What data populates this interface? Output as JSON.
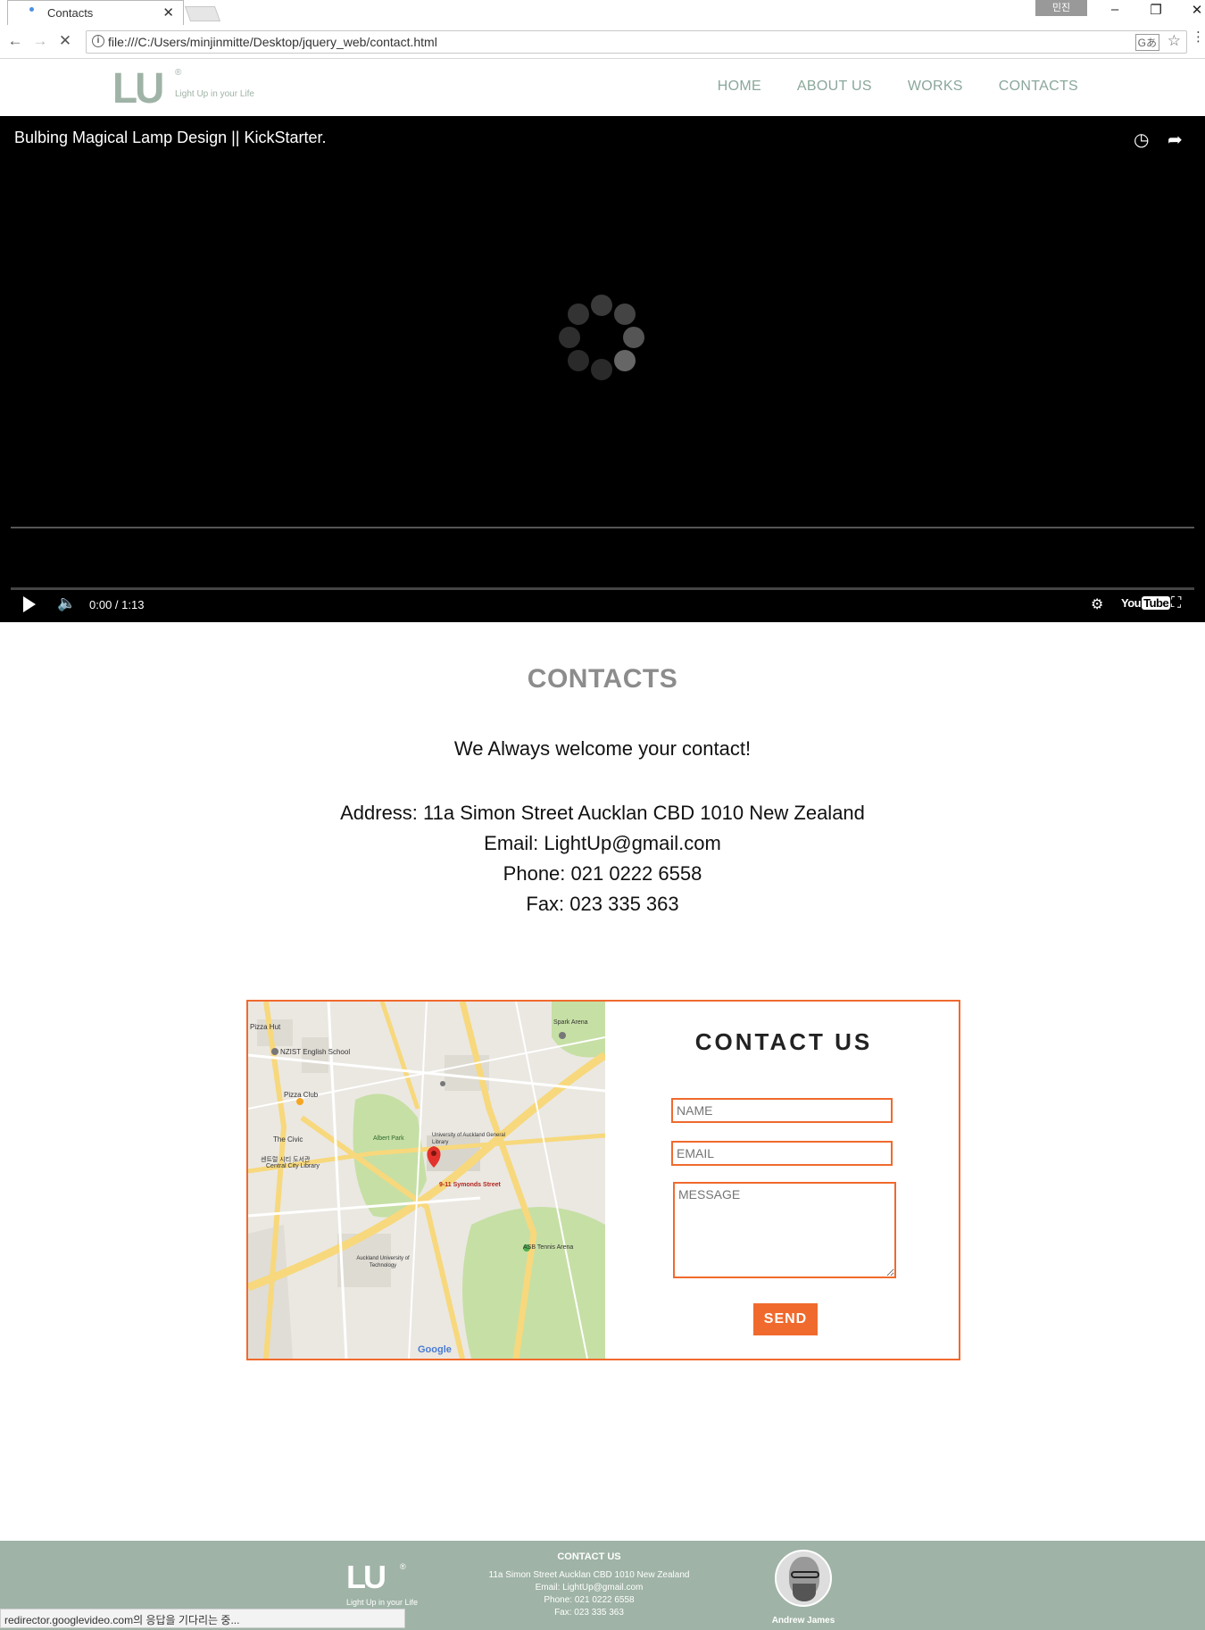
{
  "browser": {
    "tab_title": "Contacts",
    "tab_close": "✕",
    "profile_label": "민진",
    "url": "file:///C:/Users/minjinmitte/Desktop/jquery_web/contact.html",
    "translate_icon": "translate-icon",
    "status_text": "redirector.googlevideo.com의 응답을 기다리는 중..."
  },
  "header": {
    "logo_mark": "LU",
    "logo_reg": "®",
    "logo_tagline": "Light Up in your Life",
    "nav": [
      "HOME",
      "ABOUT US",
      "WORKS",
      "CONTACTS"
    ],
    "nav_color": "#8aa79a"
  },
  "video": {
    "title": "Bulbing Magical Lamp Design || KickStarter.",
    "time": "0:00 / 1:13",
    "youtube_label": "You",
    "youtube_badge": "Tube"
  },
  "contacts": {
    "title": "CONTACTS",
    "welcome": "We Always welcome your contact!",
    "address": "Address: 11a Simon Street Aucklan CBD 1010 New Zealand",
    "email": "Email: LightUp@gmail.com",
    "phone": "Phone: 021 0222 6558",
    "fax": "Fax: 023 335 363"
  },
  "form": {
    "title": "CONTACT US",
    "name_placeholder": "NAME",
    "email_placeholder": "EMAIL",
    "message_placeholder": "MESSAGE",
    "send_label": "SEND",
    "accent": "#f06a2d"
  },
  "map": {
    "labels": {
      "pizza_hut": "Pizza Hut",
      "nzist": "NZIST English School",
      "pizza_club": "Pizza Club",
      "albert_park": "Albert Park",
      "the_civic": "The Civic",
      "central_city_library": "Central City Library",
      "library_kr": "센트럴 시티 도서관",
      "univ_library": "University of Auckland General Library",
      "marker": "9-11 Symonds Street",
      "aut": "Auckland University of Technology",
      "spark_arena": "Spark Arena",
      "asb_tennis": "ASB Tennis Arena",
      "google": "Google"
    }
  },
  "footer": {
    "logo_mark": "LU",
    "logo_reg": "®",
    "logo_tagline": "Light Up in your Life",
    "heading": "CONTACT US",
    "address": "11a Simon Street Aucklan CBD 1010 New Zealand",
    "email": "Email: LightUp@gmail.com",
    "phone": "Phone: 021 0222 6558",
    "fax": "Fax: 023 335 363",
    "person_name": "Andrew James",
    "bg": "#9fb3a6"
  }
}
